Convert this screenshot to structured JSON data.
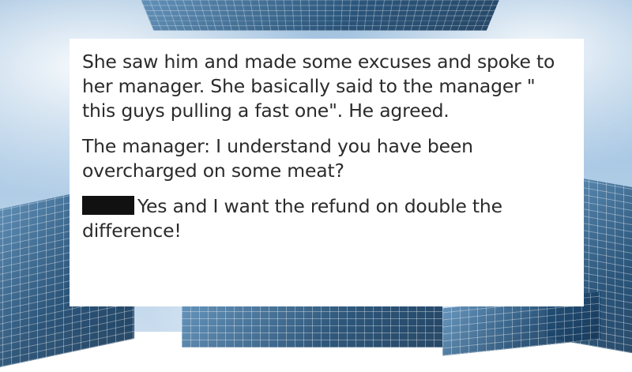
{
  "card": {
    "paragraphs": [
      "She saw him and made some excuses and spoke to her manager. She basically said to the manager \" this guys pulling a fast one\". He agreed.",
      "The manager: I understand you have been overcharged on some meat?"
    ],
    "reply": "Yes and I want the refund on double the difference!"
  },
  "colors": {
    "card_background": "#ffffff",
    "text": "#2b2b2b",
    "redaction": "#111111"
  }
}
